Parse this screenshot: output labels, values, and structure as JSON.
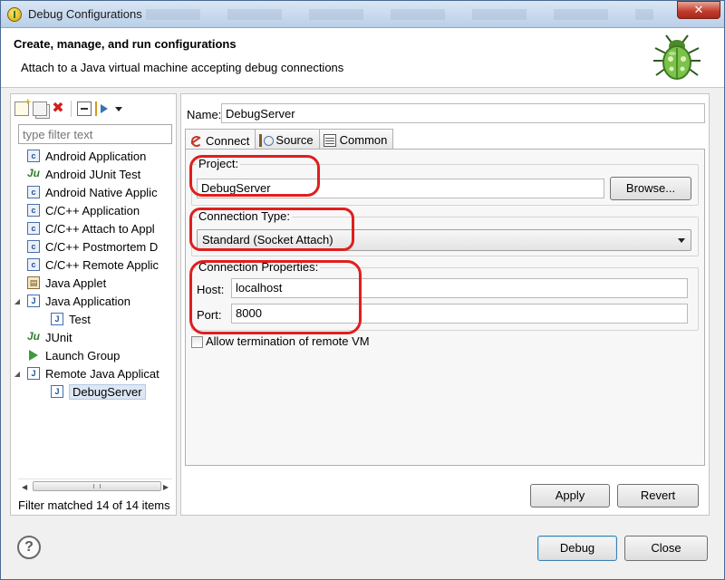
{
  "window": {
    "title": "Debug Configurations",
    "close_glyph": "✕"
  },
  "banner": {
    "heading": "Create, manage, and run configurations",
    "description": "Attach to a Java virtual machine accepting debug connections"
  },
  "left": {
    "filter_placeholder": "type filter text",
    "toolbar_icons": [
      "new-configuration-icon",
      "duplicate-icon",
      "delete-icon",
      "collapse-all-icon",
      "filter-icon",
      "dropdown-icon"
    ],
    "tree": [
      {
        "label": "Android Application",
        "icon": "c",
        "level": 0
      },
      {
        "label": "Android JUnit Test",
        "icon": "ju",
        "level": 0
      },
      {
        "label": "Android Native Applic",
        "icon": "c",
        "level": 0
      },
      {
        "label": "C/C++ Application",
        "icon": "c",
        "level": 0
      },
      {
        "label": "C/C++ Attach to Appl",
        "icon": "c",
        "level": 0
      },
      {
        "label": "C/C++ Postmortem D",
        "icon": "c",
        "level": 0
      },
      {
        "label": "C/C++ Remote Applic",
        "icon": "c",
        "level": 0
      },
      {
        "label": "Java Applet",
        "icon": "applet",
        "level": 0
      },
      {
        "label": "Java Application",
        "icon": "j",
        "level": 0
      },
      {
        "label": "Test",
        "icon": "j",
        "level": 1
      },
      {
        "label": "JUnit",
        "icon": "ju",
        "level": 0
      },
      {
        "label": "Launch Group",
        "icon": "launch",
        "level": 0
      },
      {
        "label": "Remote Java Applicat",
        "icon": "rj",
        "level": 0
      },
      {
        "label": "DebugServer",
        "icon": "rj",
        "level": 1
      }
    ],
    "status": "Filter matched 14 of 14 items"
  },
  "right": {
    "name_label": "Name:",
    "name_value": "DebugServer",
    "tabs": [
      {
        "label": "Connect",
        "icon": "connect-icon"
      },
      {
        "label": "Source",
        "icon": "source-icon"
      },
      {
        "label": "Common",
        "icon": "common-icon"
      }
    ],
    "project": {
      "label": "Project:",
      "value": "DebugServer",
      "browse": "Browse..."
    },
    "connection_type": {
      "label": "Connection Type:",
      "value": "Standard (Socket Attach)"
    },
    "connection_props": {
      "label": "Connection Properties:",
      "host_label": "Host:",
      "host_value": "localhost",
      "port_label": "Port:",
      "port_value": "8000"
    },
    "allow_termination": {
      "label": "Allow termination of remote VM",
      "checked": false
    },
    "apply": "Apply",
    "revert": "Revert"
  },
  "footer": {
    "help": "?",
    "debug": "Debug",
    "close": "Close"
  },
  "colors": {
    "annotation": "#e01e1e",
    "selection": "#dde7f4"
  }
}
